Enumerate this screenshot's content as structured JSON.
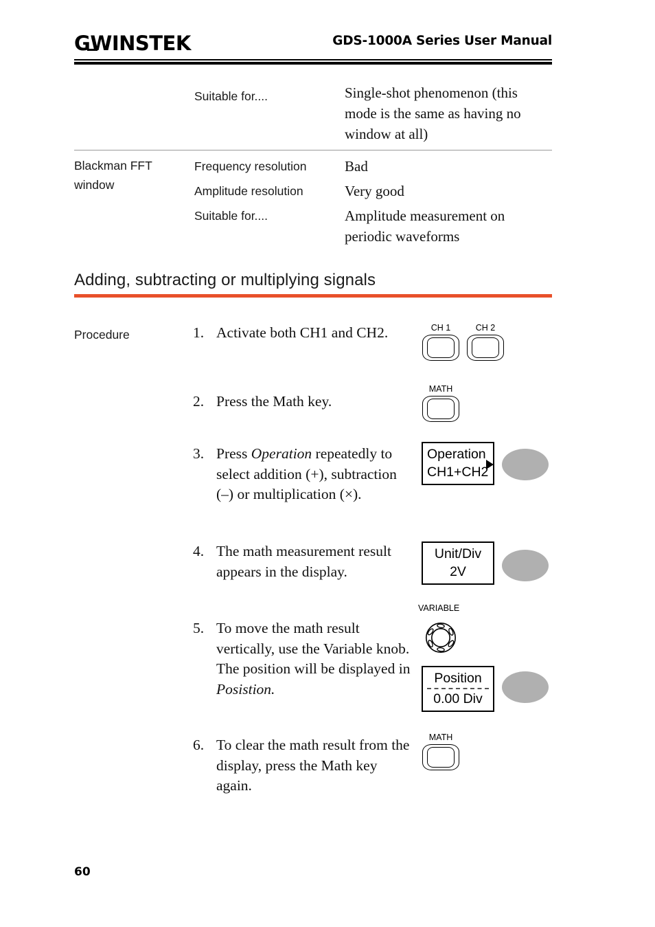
{
  "header": {
    "logo_gw": "G",
    "logo_w": "W",
    "logo_instek": "INSTEK",
    "title": "GDS-1000A Series User Manual"
  },
  "table": {
    "rows": [
      {
        "name": "",
        "items": [
          {
            "label": "Suitable for....",
            "value": "Single-shot phenomenon (this mode is the same as having no window at all)"
          }
        ]
      },
      {
        "name": "Blackman FFT window",
        "items": [
          {
            "label": "Frequency resolution",
            "value": "Bad"
          },
          {
            "label": "Amplitude resolution",
            "value": "Very good"
          },
          {
            "label": "Suitable for....",
            "value": "Amplitude measurement on periodic waveforms"
          }
        ]
      }
    ]
  },
  "section": {
    "heading": "Adding, subtracting or multiplying signals",
    "rule_color": "#E8502A"
  },
  "procedure": {
    "label": "Procedure",
    "steps": [
      {
        "num": "1.",
        "text_pre": "Activate both CH1 and CH2.",
        "italic": "",
        "text_post": ""
      },
      {
        "num": "2.",
        "text_pre": "Press the Math key.",
        "italic": "",
        "text_post": ""
      },
      {
        "num": "3.",
        "text_pre": "Press ",
        "italic": "Operation",
        "text_post": " repeatedly to select addition (+), subtraction (–) or multiplication (×)."
      },
      {
        "num": "4.",
        "text_pre": "The math measurement result appears in the display.",
        "italic": "",
        "text_post": ""
      },
      {
        "num": "5.",
        "text_pre": "To move the math result vertically, use the Variable knob. The position will be displayed in ",
        "italic": "Posistion.",
        "text_post": ""
      },
      {
        "num": "6.",
        "text_pre": "To clear the math result from the display, press the Math key again.",
        "italic": "",
        "text_post": ""
      }
    ]
  },
  "graphics": {
    "keys": {
      "ch1": "CH 1",
      "ch2": "CH 2",
      "math": "MATH",
      "math2": "MATH"
    },
    "knob": {
      "label": "VARIABLE"
    },
    "operation_box": {
      "line1": "Operation",
      "line2": "CH1+CH2"
    },
    "unitdiv_box": {
      "line1": "Unit/Div",
      "line2": "2V"
    },
    "position_box": {
      "line1": "Position",
      "line2": "0.00 Div"
    },
    "softkey_color": "#B0B0B0"
  },
  "footer": {
    "page_number": "60"
  }
}
